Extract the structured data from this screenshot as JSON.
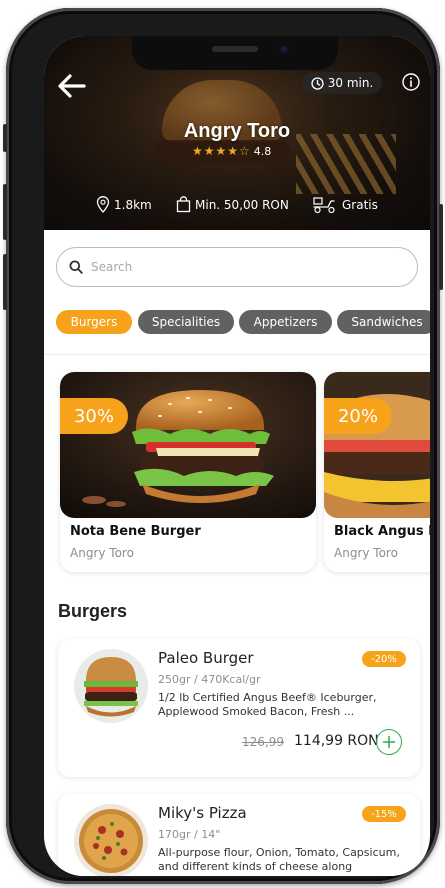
{
  "header": {
    "delivery_time": "30 min.",
    "restaurant_name": "Angry Toro",
    "rating": "4.8",
    "distance": "1.8km",
    "min_order": "Min. 50,00 RON",
    "delivery_fee": "Gratis"
  },
  "search": {
    "placeholder": "Search"
  },
  "categories": [
    "Burgers",
    "Specialities",
    "Appetizers",
    "Sandwiches"
  ],
  "active_category": "Burgers",
  "promos": [
    {
      "discount": "30%",
      "name": "Nota Bene Burger",
      "restaurant": "Angry Toro"
    },
    {
      "discount": "20%",
      "name": "Black Angus B",
      "restaurant": "Angry Toro"
    }
  ],
  "section_title": "Burgers",
  "items": [
    {
      "name": "Paleo Burger",
      "meta": "250gr  /  470Kcal/gr",
      "description": "1/2 lb Certified Angus Beef® Iceburger, Applewood Smoked Bacon, Fresh ...",
      "badge": "-20%",
      "old_price": "126,99",
      "price": "114,99 RON"
    },
    {
      "name": "Miky's Pizza",
      "meta": "170gr / 14\"",
      "description": "All-purpose flour, Onion, Tomato, Capsicum, and different kinds of cheese along",
      "badge": "-15%"
    }
  ],
  "colors": {
    "accent": "#f6a21b",
    "chip_inactive": "#616161",
    "add_green": "#34a853"
  },
  "icons": [
    "back-arrow-icon",
    "clock-icon",
    "info-icon",
    "star-icon",
    "location-pin-icon",
    "shopping-bag-icon",
    "delivery-scooter-icon",
    "search-icon",
    "plus-icon"
  ]
}
